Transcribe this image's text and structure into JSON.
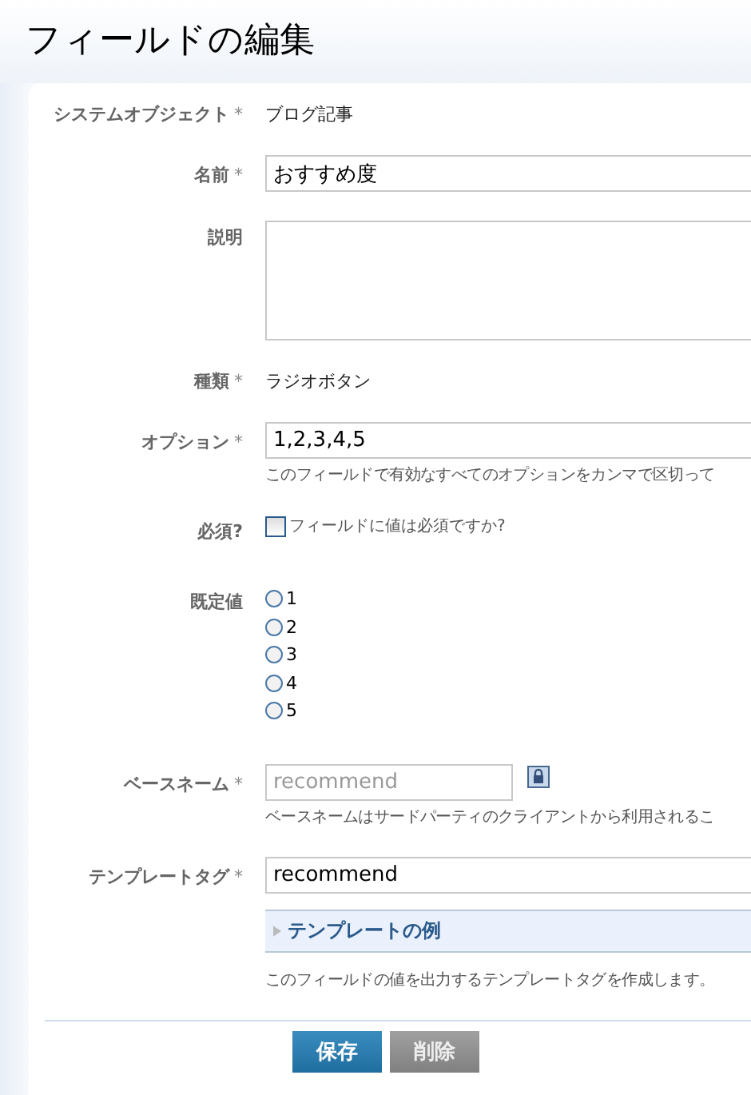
{
  "title": "フィールドの編集",
  "fields": [
    {
      "kind": "static",
      "label": "システムオブジェクト",
      "mark": "*",
      "value": "ブログ記事"
    },
    {
      "kind": "input",
      "label": "名前",
      "mark": "*",
      "value": "おすすめ度"
    },
    {
      "kind": "textarea",
      "label": "説明"
    },
    {
      "kind": "static",
      "label": "種類",
      "mark": "*",
      "value": "ラジオボタン"
    },
    {
      "kind": "input",
      "label": "オプション",
      "mark": "*",
      "value": "1,2,3,4,5",
      "hint": "このフィールドで有効なすべてのオプションをカンマで区切って"
    },
    {
      "kind": "checkbox",
      "label": "必須?",
      "checked": false,
      "text": "フィールドに値は必須ですか?"
    },
    {
      "kind": "radio",
      "label": "既定値",
      "options": [
        {
          "label": "1",
          "selected": false
        },
        {
          "label": "2",
          "selected": false
        },
        {
          "label": "3",
          "selected": false
        },
        {
          "label": "4",
          "selected": false
        },
        {
          "label": "5",
          "selected": false
        }
      ]
    },
    {
      "kind": "locked",
      "label": "ベースネーム",
      "mark": "*",
      "value": "recommend",
      "disabled": true,
      "hint": "ベースネームはサードパーティのクライアントから利用されるこ"
    },
    {
      "kind": "input",
      "label": "テンプレートタグ",
      "mark": "*",
      "value": "recommend",
      "expander": {
        "label": "テンプレートの例",
        "expanded": false
      },
      "hint": "このフィールドの値を出力するテンプレートタグを作成します。"
    }
  ],
  "buttons": [
    {
      "label": "保存",
      "kind": "primary"
    },
    {
      "label": "削除",
      "kind": "secondary"
    }
  ]
}
